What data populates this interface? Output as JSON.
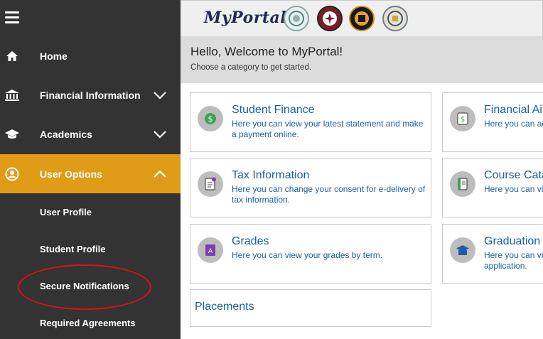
{
  "sidebar": {
    "items": [
      {
        "label": "Home",
        "icon": "home-icon"
      },
      {
        "label": "Financial Information",
        "icon": "bank-icon"
      },
      {
        "label": "Academics",
        "icon": "graduation-cap-icon"
      },
      {
        "label": "User Options",
        "icon": "user-icon"
      }
    ],
    "sub_items": [
      {
        "label": "User Profile"
      },
      {
        "label": "Student Profile"
      },
      {
        "label": "Secure Notifications"
      },
      {
        "label": "Required Agreements"
      }
    ],
    "active_color": "#e09b17"
  },
  "header": {
    "logo": "MyPortal"
  },
  "welcome": {
    "title": "Hello, Welcome to MyPortal!",
    "subtitle": "Choose a category to get started."
  },
  "cards": [
    {
      "title": "Student Finance",
      "desc": "Here you can view your latest statement and make a payment online.",
      "icon": "dollar-icon"
    },
    {
      "title": "Financial Ai",
      "desc": "Here you can ac",
      "icon": "money-icon"
    },
    {
      "title": "Tax Information",
      "desc": "Here you can change your consent for e-delivery of tax information.",
      "icon": "tax-document-icon"
    },
    {
      "title": "Course Cata",
      "desc": "Here you can vi",
      "icon": "notebook-icon"
    },
    {
      "title": "Grades",
      "desc": "Here you can view your grades by term.",
      "icon": "grades-icon"
    },
    {
      "title": "Graduation",
      "desc": "Here you can vi application.",
      "icon": "graduation-icon"
    },
    {
      "title": "Placements",
      "desc": "",
      "icon": ""
    }
  ],
  "link_color": "#1b5fa6"
}
